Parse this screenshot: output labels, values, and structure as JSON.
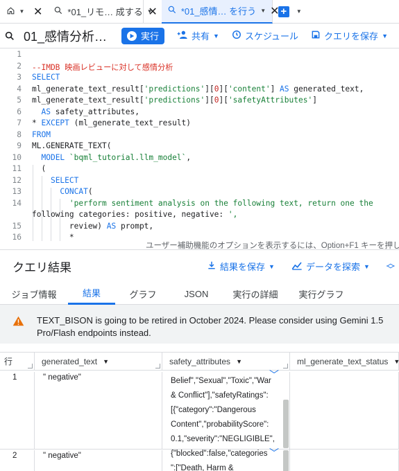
{
  "tabs": [
    {
      "label": "*01_リモ… 成する",
      "active": false
    },
    {
      "label": "*01_感情… を行う",
      "active": true
    }
  ],
  "toolbar": {
    "query_title": "01_感情分析…",
    "run_label": "実行",
    "share_label": "共有",
    "schedule_label": "スケジュール",
    "save_query_label": "クエリを保存"
  },
  "editor": {
    "line_numbers": [
      "1",
      "2",
      "3",
      "4",
      "5",
      "6",
      "7",
      "8",
      "9",
      "10",
      "11",
      "12",
      "13",
      "14",
      "",
      "15",
      "16"
    ],
    "code_lines": [
      "",
      "--IMDB 映画レビューに対して感情分析",
      "SELECT",
      "ml_generate_text_result['predictions'][0]['content'] AS generated_text,",
      "ml_generate_text_result['predictions'][0]['safetyAttributes']",
      "  AS safety_attributes,",
      "* EXCEPT (ml_generate_text_result)",
      "FROM",
      "ML.GENERATE_TEXT(",
      "  MODEL `bqml_tutorial.llm_model`,",
      "  (",
      "    SELECT",
      "      CONCAT(",
      "        'perform sentiment analysis on the following text, return one the",
      "following categories: positive, negative: ',",
      "        review) AS prompt,",
      "        *"
    ],
    "accessibility_hint": "ユーザー補助機能のオプションを表示するには、Option+F1 キーを押しま"
  },
  "results": {
    "title": "クエリ結果",
    "save_results_label": "結果を保存",
    "explore_label": "データを探索",
    "tabs": [
      "ジョブ情報",
      "結果",
      "グラフ",
      "JSON",
      "実行の詳細",
      "実行グラフ"
    ],
    "active_tab": "結果"
  },
  "warning": {
    "text": "TEXT_BISON is going to be retired in October 2024. Please consider using Gemini 1.5 Pro/Flash endpoints instead."
  },
  "table": {
    "row_header": "行",
    "columns": [
      "generated_text",
      "safety_attributes",
      "ml_generate_text_status"
    ],
    "rows": [
      {
        "num": "1",
        "generated_text": "\" negative\"",
        "safety_attributes": "Belief\",\"Sexual\",\"Toxic\",\"War\n& Conflict\"],\"safetyRatings\":\n[{\"category\":\"Dangerous\nContent\",\"probabilityScore\":\n0.1,\"severity\":\"NEGLIGIBLE\",",
        "status": ""
      },
      {
        "num": "2",
        "generated_text": "\" negative\"",
        "safety_attributes": "{\"blocked\":false,\"categories\n\":[\"Death, Harm &",
        "status": ""
      }
    ]
  },
  "colors": {
    "accent": "#1a73e8",
    "warning": "#e8710a"
  }
}
